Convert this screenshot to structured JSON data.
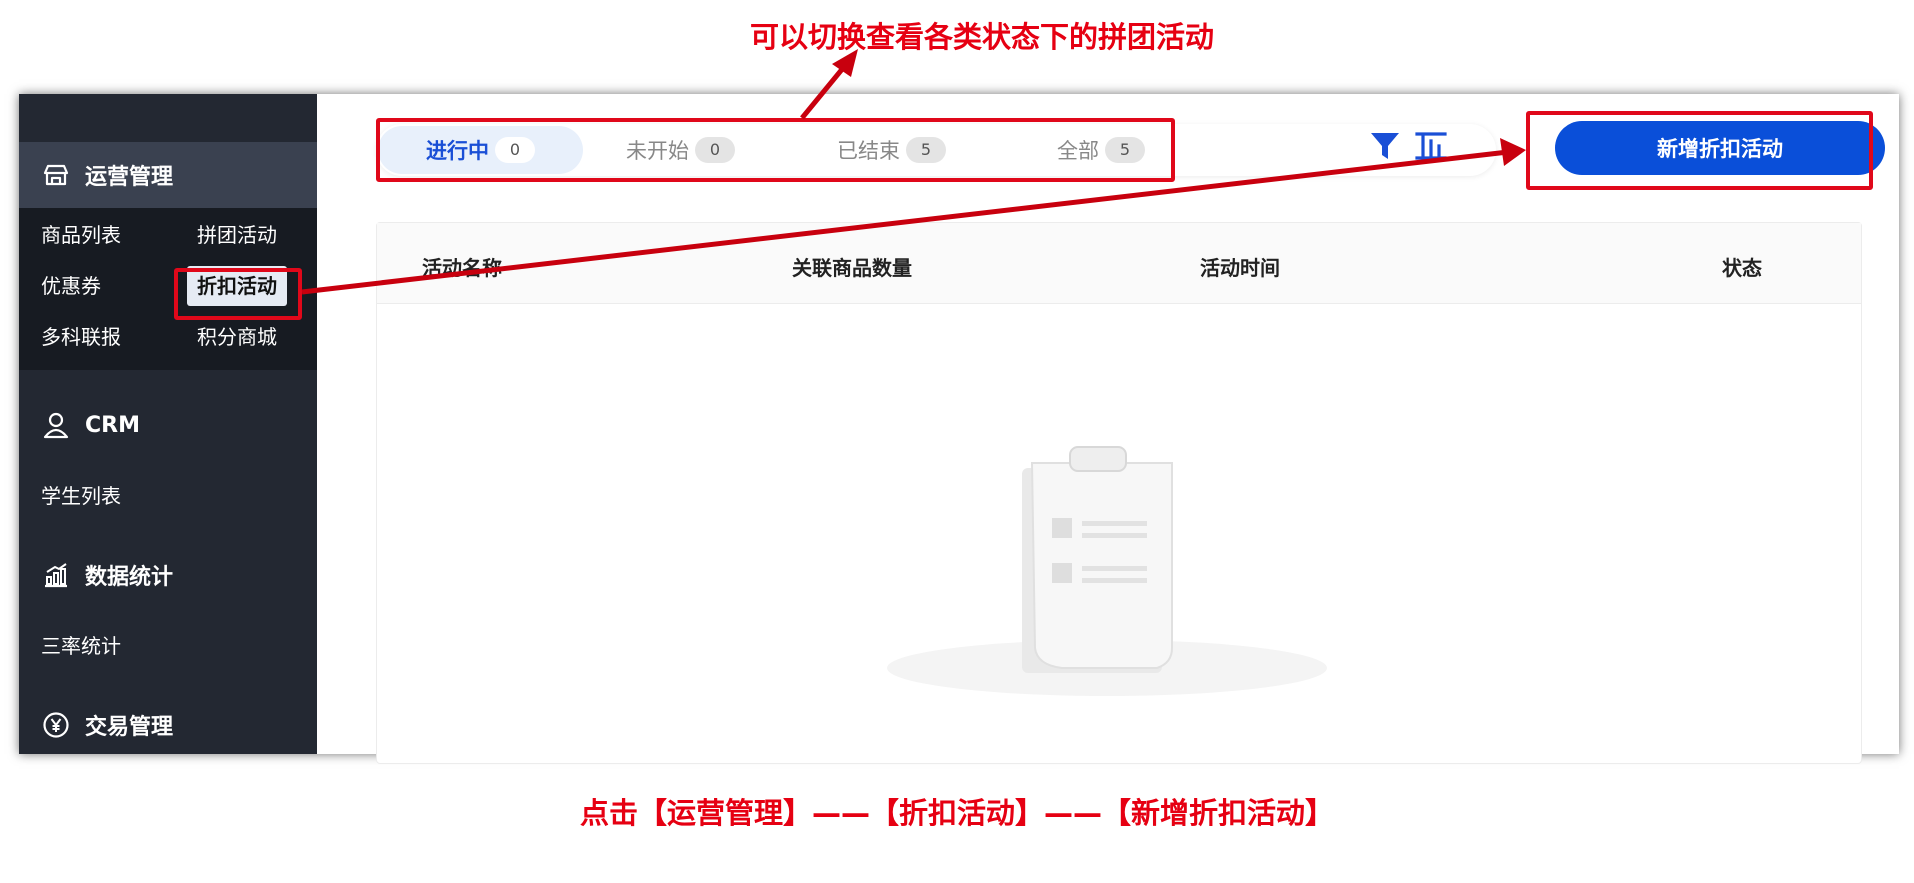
{
  "annotations": {
    "top": "可以切换查看各类状态下的拼团活动",
    "bottom": "点击【运营管理】——【折扣活动】——【新增折扣活动】"
  },
  "sidebar": {
    "sections": [
      {
        "title": "运营管理",
        "icon": "store-icon"
      },
      {
        "title": "CRM",
        "icon": "user-icon"
      },
      {
        "title": "数据统计",
        "icon": "bar-chart-icon"
      },
      {
        "title": "交易管理",
        "icon": "yen-circle-icon"
      }
    ],
    "ops_items": [
      "商品列表",
      "拼团活动",
      "优惠券",
      "折扣活动",
      "多科联报",
      "积分商城"
    ],
    "active_item": "折扣活动",
    "crm_items": [
      "学生列表"
    ],
    "stats_items": [
      "三率统计"
    ]
  },
  "tabs": [
    {
      "label": "进行中",
      "count": "0"
    },
    {
      "label": "未开始",
      "count": "0"
    },
    {
      "label": "已结束",
      "count": "5"
    },
    {
      "label": "全部",
      "count": "5"
    }
  ],
  "toolbar": {
    "add_button": "新增折扣活动",
    "icons": [
      "filter-icon",
      "sort-icon"
    ]
  },
  "table": {
    "columns": [
      "活动名称",
      "关联商品数量",
      "活动时间",
      "状态"
    ],
    "rows": []
  },
  "colors": {
    "accent": "#0a4fd9",
    "annotation": "#e0081a",
    "sidebar": "#232832"
  }
}
